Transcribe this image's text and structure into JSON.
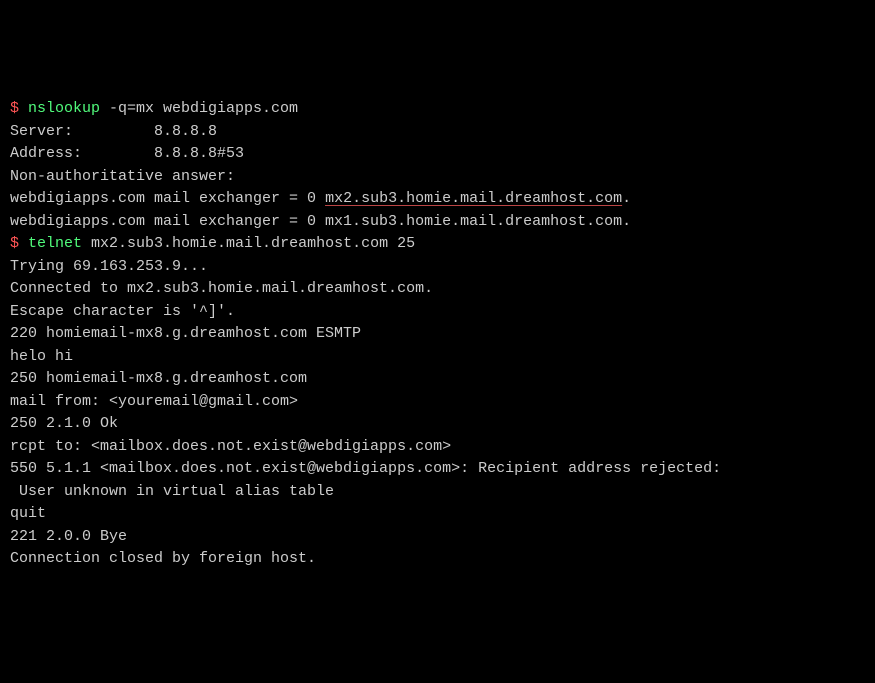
{
  "terminal": {
    "line1": {
      "prompt": "$ ",
      "command": "nslookup",
      "args": " -q=mx webdigiapps.com"
    },
    "line2": "Server:         8.8.8.8",
    "line3": "Address:        8.8.8.8#53",
    "line4": "",
    "line5": "Non-authoritative answer:",
    "line6a": "webdigiapps.com mail exchanger = 0 ",
    "line6b": "mx2.sub3.homie.mail.dreamhost.com",
    "line6c": ".",
    "line7": "webdigiapps.com mail exchanger = 0 mx1.sub3.homie.mail.dreamhost.com.",
    "line8": "",
    "line9": {
      "prompt": "$ ",
      "command": "telnet",
      "args": " mx2.sub3.homie.mail.dreamhost.com 25"
    },
    "line10": "Trying 69.163.253.9...",
    "line11": "Connected to mx2.sub3.homie.mail.dreamhost.com.",
    "line12": "Escape character is '^]'.",
    "line13": "220 homiemail-mx8.g.dreamhost.com ESMTP",
    "line14": "helo hi",
    "line15": "250 homiemail-mx8.g.dreamhost.com",
    "line16": "mail from: <youremail@gmail.com>",
    "line17": "250 2.1.0 Ok",
    "line18": "rcpt to: <mailbox.does.not.exist@webdigiapps.com>",
    "line19": "550 5.1.1 <mailbox.does.not.exist@webdigiapps.com>: Recipient address rejected:",
    "line20": " User unknown in virtual alias table",
    "line21": "quit",
    "line22": "221 2.0.0 Bye",
    "line23": "Connection closed by foreign host."
  }
}
